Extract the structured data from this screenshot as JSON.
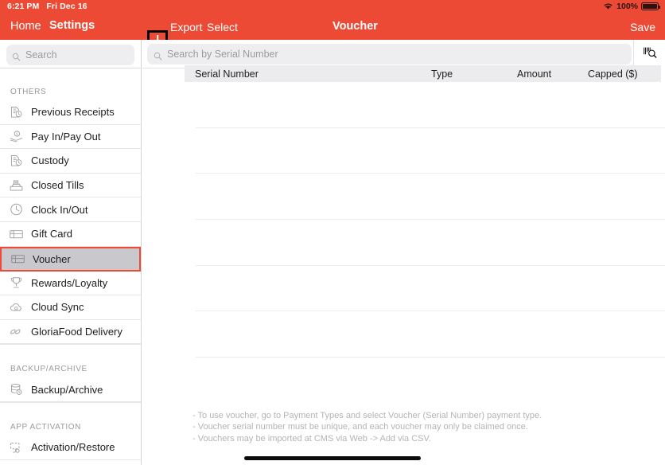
{
  "status_bar": {
    "time": "6:21 PM",
    "date": "Fri Dec 16",
    "battery_percent": "100%",
    "wifi_icon": "wifi-icon",
    "battery_icon": "battery-full-icon"
  },
  "nav": {
    "home_label": "Home",
    "settings_label": "Settings",
    "add_icon": "plus-icon",
    "export_label": "Export",
    "select_label": "Select",
    "title": "Voucher",
    "save_label": "Save",
    "accent_color": "#ec4a34"
  },
  "sidebar": {
    "search": {
      "placeholder": "Search",
      "icon": "search-icon"
    },
    "sections": [
      {
        "header": "OTHERS",
        "items": [
          {
            "label": "Previous Receipts",
            "icon": "receipt-icon",
            "selected": false
          },
          {
            "label": "Pay In/Pay Out",
            "icon": "cash-hand-icon",
            "selected": false
          },
          {
            "label": "Custody",
            "icon": "receipt-icon",
            "selected": false
          },
          {
            "label": "Closed Tills",
            "icon": "cash-register-icon",
            "selected": false
          },
          {
            "label": "Clock In/Out",
            "icon": "clock-icon",
            "selected": false
          },
          {
            "label": "Gift Card",
            "icon": "card-icon",
            "selected": false
          },
          {
            "label": "Voucher",
            "icon": "card-icon",
            "selected": true
          },
          {
            "label": "Rewards/Loyalty",
            "icon": "trophy-icon",
            "selected": false
          },
          {
            "label": "Cloud Sync",
            "icon": "cloud-sync-icon",
            "selected": false
          },
          {
            "label": "GloriaFood Delivery",
            "icon": "leaf-icon",
            "selected": false
          }
        ]
      },
      {
        "header": "BACKUP/ARCHIVE",
        "items": [
          {
            "label": "Backup/Archive",
            "icon": "database-clock-icon",
            "selected": false
          }
        ]
      },
      {
        "header": "APP ACTIVATION",
        "items": [
          {
            "label": "Activation/Restore",
            "icon": "activation-icon",
            "selected": false
          }
        ]
      }
    ]
  },
  "main": {
    "search": {
      "placeholder": "Search by Serial Number",
      "icon": "search-icon"
    },
    "scan_button_icon": "barcode-scan-icon",
    "table": {
      "columns": [
        "Serial Number",
        "Type",
        "Amount",
        "Capped ($)"
      ],
      "rows": [],
      "empty_row_count": 8
    },
    "notes": [
      "- To use voucher, go to Payment Types and select Voucher (Serial Number) payment type.",
      "- Voucher serial number must be unique, and each voucher may only be claimed once.",
      "- Vouchers may be imported at CMS via Web -> Add via CSV."
    ]
  }
}
